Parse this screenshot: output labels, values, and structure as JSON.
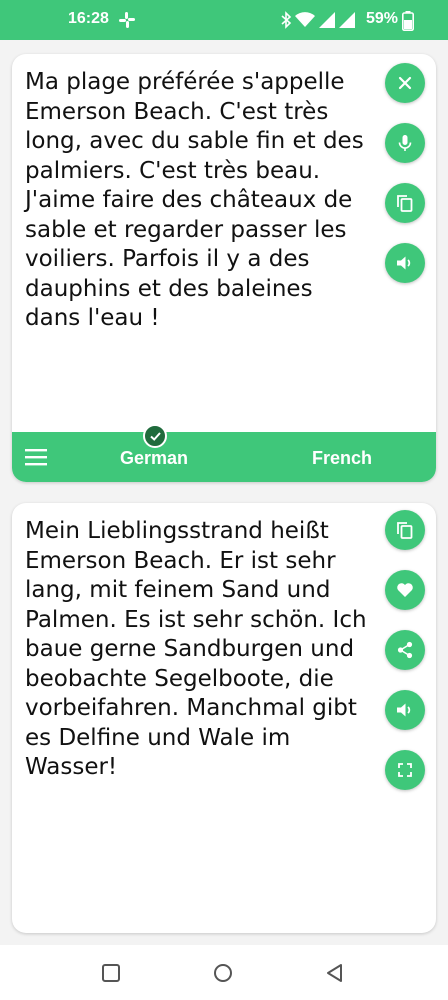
{
  "status_bar": {
    "time": "16:28",
    "battery_percent": "59%",
    "icons": [
      "slack-icon",
      "bluetooth-icon",
      "wifi-icon",
      "signal-icon",
      "signal-icon",
      "battery-icon"
    ]
  },
  "source_card": {
    "text": "Ma plage préférée s'appelle Emerson Beach. C'est très long, avec du sable fin et des palmiers. C'est très beau. J'aime faire des châteaux de sable et regarder passer les voiliers. Parfois il y a des dauphins et des baleines dans l'eau !",
    "actions": [
      "close-icon",
      "microphone-icon",
      "copy-icon",
      "speaker-icon"
    ]
  },
  "language_bar": {
    "source_language": "German",
    "target_language": "French",
    "menu_icon": "menu-icon",
    "selected_icon": "check-icon"
  },
  "target_card": {
    "text": "Mein Lieblingsstrand heißt Emerson Beach. Er ist sehr lang, mit feinem Sand und Palmen. Es ist sehr schön. Ich baue gerne Sandburgen und beobachte Segelboote, die vorbeifahren. Manchmal gibt es Delfine und Wale im Wasser!",
    "actions": [
      "copy-icon",
      "heart-icon",
      "share-icon",
      "speaker-icon",
      "fullscreen-icon"
    ]
  },
  "nav_bar": {
    "buttons": [
      "recents-icon",
      "home-icon",
      "back-icon"
    ]
  },
  "colors": {
    "accent": "#3fc77a",
    "check_badge": "#1f6b3c",
    "background": "#f3f3f3"
  }
}
